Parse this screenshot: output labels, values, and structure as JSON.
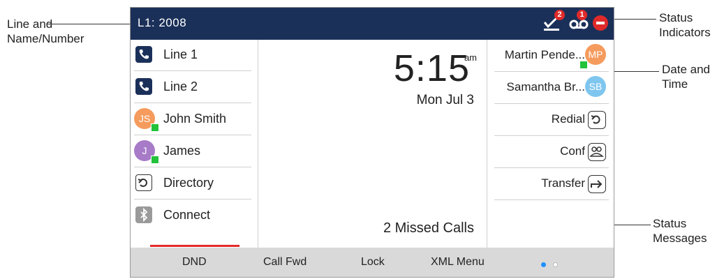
{
  "callouts": {
    "line_and_name": "Line and\nName/Number",
    "status_indicators": "Status\nIndicators",
    "date_and_time": "Date and\nTime",
    "status_messages": "Status\nMessages"
  },
  "topbar": {
    "title": "L1: 2008",
    "vm_count": "2",
    "voicemail_count": "1"
  },
  "left_keys": [
    {
      "label": "Line 1",
      "icon": "phone-icon"
    },
    {
      "label": "Line 2",
      "icon": "phone-icon"
    },
    {
      "label": "John Smith",
      "initials": "JS",
      "color": "#f59b5d"
    },
    {
      "label": "James",
      "initials": "J",
      "color": "#a77bc8"
    },
    {
      "label": "Directory",
      "icon": "directory-icon"
    },
    {
      "label": "Connect",
      "icon": "bluetooth-icon"
    }
  ],
  "center": {
    "time": "5:15",
    "ampm": "am",
    "date": "Mon Jul 3",
    "missed": "2  Missed Calls"
  },
  "right_keys": [
    {
      "label": "Martin Pende...",
      "initials": "MP",
      "color": "#f59b5d"
    },
    {
      "label": "Samantha Br...",
      "initials": "SB",
      "color": "#7fc6ef"
    },
    {
      "label": "Redial",
      "icon": "redial-icon"
    },
    {
      "label": "Conf",
      "icon": "conference-icon"
    },
    {
      "label": "Transfer",
      "icon": "transfer-icon"
    }
  ],
  "softkeys": [
    "DND",
    "Call Fwd",
    "Lock",
    "XML Menu"
  ],
  "colors": {
    "topbar": "#1b3059",
    "accent": "#1e90ff",
    "presence": "#22c23a",
    "alert": "#e02a2a"
  }
}
